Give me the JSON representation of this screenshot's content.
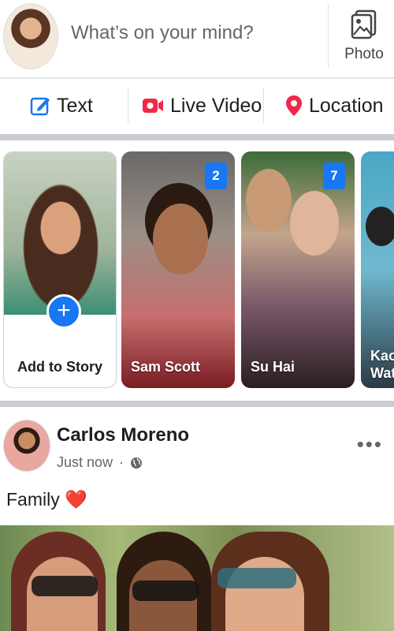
{
  "composer": {
    "prompt": "What’s on your mind?",
    "photo_label": "Photo"
  },
  "actions": [
    {
      "label": "Text",
      "icon": "edit-icon",
      "color": "#1877f2"
    },
    {
      "label": "Live Video",
      "icon": "video-camera-icon",
      "color": "#f02849"
    },
    {
      "label": "Location",
      "icon": "location-pin-icon",
      "color": "#f02849"
    }
  ],
  "stories": {
    "add_label": "Add to Story",
    "items": [
      {
        "name": "Sam Scott",
        "count": "2"
      },
      {
        "name": "Su Hai",
        "count": "7"
      },
      {
        "name_line1": "Kao",
        "name_line2": "Wat"
      }
    ]
  },
  "post": {
    "author": "Carlos Moreno",
    "time": "Just now",
    "separator": "·",
    "text": "Family",
    "emoji": "❤️",
    "more": "•••"
  },
  "colors": {
    "accent": "#1877f2",
    "live": "#f02849",
    "divider": "#c9ccd1"
  }
}
